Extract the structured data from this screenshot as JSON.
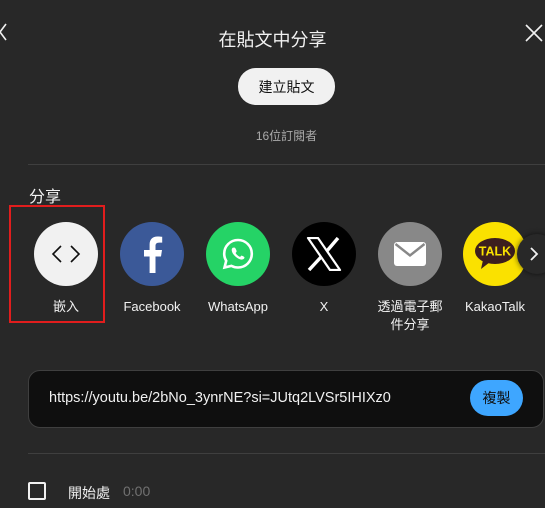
{
  "dialog": {
    "title": "在貼文中分享",
    "create_post_label": "建立貼文",
    "subscriber_count": "16位訂閱者"
  },
  "share": {
    "heading": "分享",
    "items": [
      {
        "label": "嵌入",
        "icon": "embed-code-icon",
        "color": "#f1f1f1"
      },
      {
        "label": "Facebook",
        "icon": "facebook-icon",
        "color": "#3b5998"
      },
      {
        "label": "WhatsApp",
        "icon": "whatsapp-icon",
        "color": "#25d366"
      },
      {
        "label": "X",
        "icon": "x-icon",
        "color": "#000000"
      },
      {
        "label": "透過電子郵\n件分享",
        "icon": "email-icon",
        "color": "#888888"
      },
      {
        "label": "KakaoTalk",
        "icon": "kakaotalk-icon",
        "color": "#fae100"
      }
    ],
    "kakao_badge": "TALK"
  },
  "link": {
    "url": "https://youtu.be/2bNo_3ynrNE?si=JUtq2LVSr5IHIXz0",
    "copy_label": "複製"
  },
  "start_at": {
    "label": "開始處",
    "time": "0:00"
  }
}
